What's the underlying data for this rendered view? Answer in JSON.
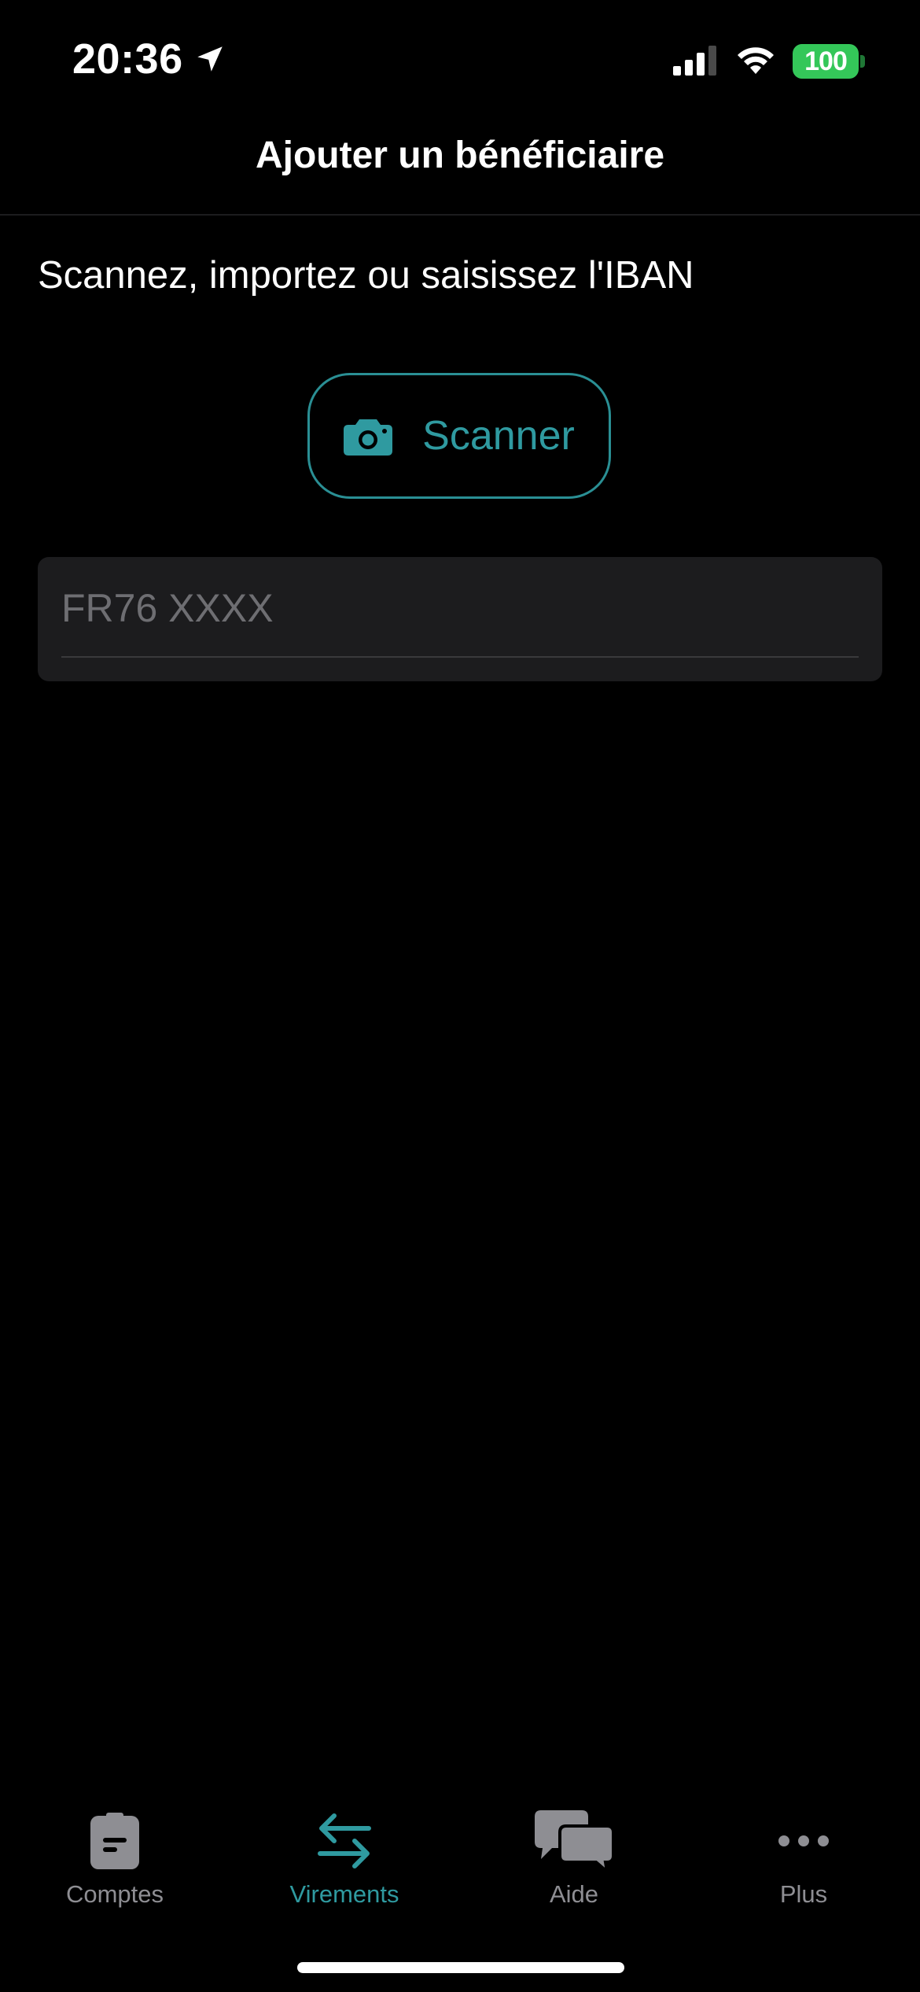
{
  "status_bar": {
    "time": "20:36",
    "battery_level": "100",
    "battery_color": "#34c759"
  },
  "header": {
    "title": "Ajouter un bénéficiaire"
  },
  "main": {
    "instruction": "Scannez, importez ou saisissez l'IBAN",
    "scan_button": {
      "label": "Scanner",
      "icon": "camera-icon",
      "accent_color": "#2f9aa0"
    },
    "iban_input": {
      "value": "",
      "placeholder": "FR76 XXXX"
    }
  },
  "tab_bar": {
    "active_tab": "Virements",
    "tabs": [
      {
        "label": "Comptes",
        "icon": "document-icon"
      },
      {
        "label": "Virements",
        "icon": "transfer-arrows-icon"
      },
      {
        "label": "Aide",
        "icon": "chat-bubbles-icon"
      },
      {
        "label": "Plus",
        "icon": "more-icon"
      }
    ]
  }
}
